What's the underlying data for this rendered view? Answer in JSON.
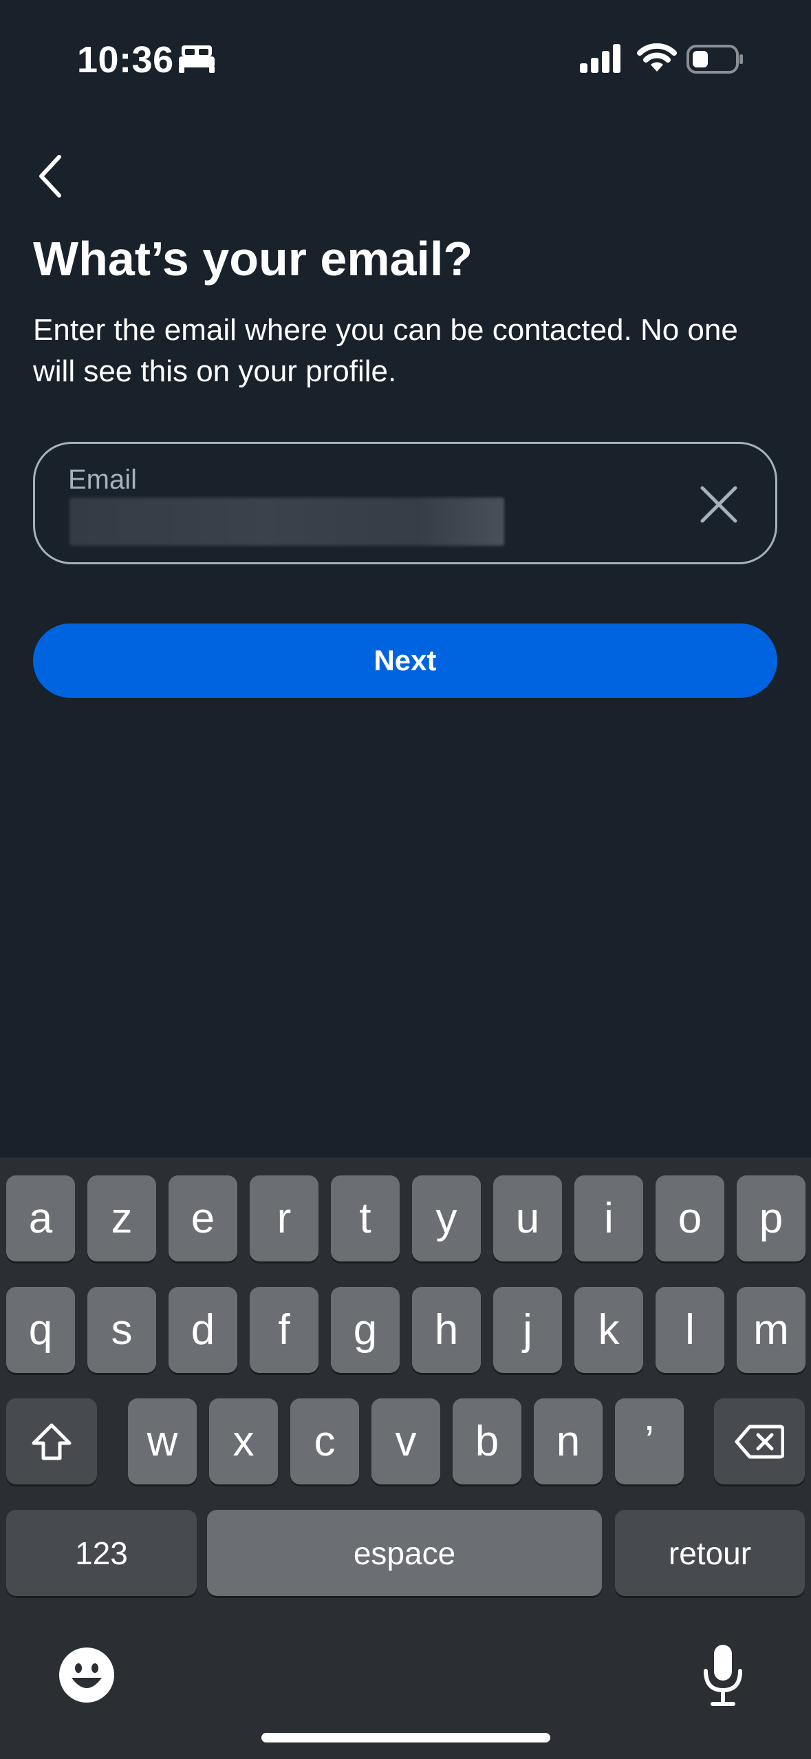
{
  "status_bar": {
    "time": "10:36",
    "icons": [
      "bed-icon",
      "cellular-signal-icon",
      "wifi-icon",
      "battery-icon"
    ]
  },
  "header": {
    "back_icon": "chevron-left-icon",
    "title": "What’s your email?",
    "subtitle": "Enter the email where you can be contacted. No one will see this on your profile."
  },
  "email_field": {
    "label": "Email",
    "value": "",
    "clear_icon": "close-icon"
  },
  "next_button": {
    "label": "Next"
  },
  "keyboard": {
    "row1": [
      "a",
      "z",
      "e",
      "r",
      "t",
      "y",
      "u",
      "i",
      "o",
      "p"
    ],
    "row2": [
      "q",
      "s",
      "d",
      "f",
      "g",
      "h",
      "j",
      "k",
      "l",
      "m"
    ],
    "row3": [
      "w",
      "x",
      "c",
      "v",
      "b",
      "n",
      "’"
    ],
    "numbers": "123",
    "space": "espace",
    "return": "retour",
    "shift_icon": "shift-icon",
    "delete_icon": "backspace-icon",
    "emoji_icon": "emoji-icon",
    "mic_icon": "microphone-icon"
  },
  "colors": {
    "background": "#19212a",
    "accent": "#0064e0",
    "keyboard": "#2b2f33",
    "key": "#6b6e72",
    "key_dark": "#474a4e",
    "muted_text": "#a7b1bc"
  }
}
